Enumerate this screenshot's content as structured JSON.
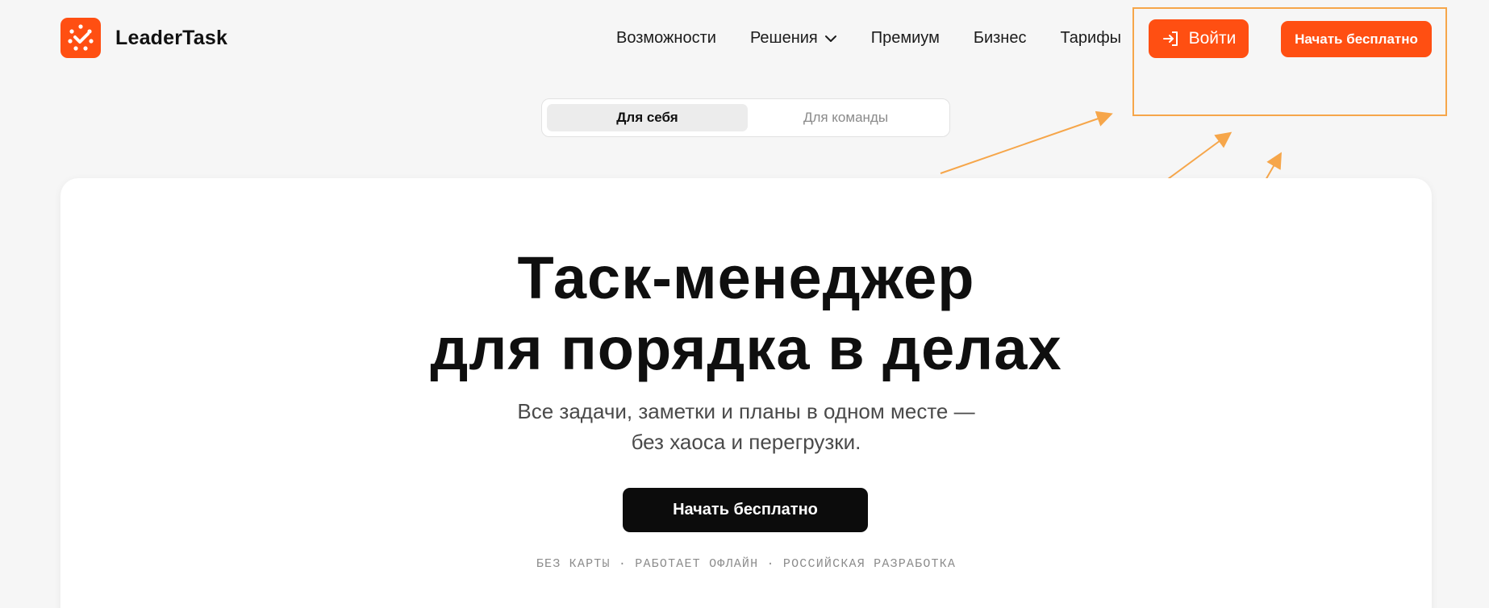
{
  "brand": {
    "name": "LeaderTask",
    "accent_color": "#ff4f12",
    "logo_icon": "checkmark-clock-icon"
  },
  "nav": {
    "items": [
      {
        "label": "Возможности"
      },
      {
        "label": "Решения",
        "icon": "chevron-down-icon"
      },
      {
        "label": "Премиум"
      },
      {
        "label": "Бизнес"
      },
      {
        "label": "Тарифы"
      }
    ],
    "login_label": "Войти",
    "login_icon": "login-icon",
    "start_label": "Начать бесплатно"
  },
  "toggle": {
    "options": [
      "Для себя",
      "Для команды"
    ],
    "selected": "Для себя"
  },
  "hero": {
    "title_line1": "Таск-менеджер",
    "title_line2": "для порядка в делах",
    "subtitle": "Все задачи, заметки и планы в одном месте — без хаоса и перегрузки.",
    "cta_label": "Начать бесплатно",
    "features_line": "БЕЗ КАРТЫ · РАБОТАЕТ ОФЛАЙН · РОССИЙСКАЯ РАЗРАБОТКА"
  },
  "annotation": {
    "color": "#f6a64a"
  }
}
